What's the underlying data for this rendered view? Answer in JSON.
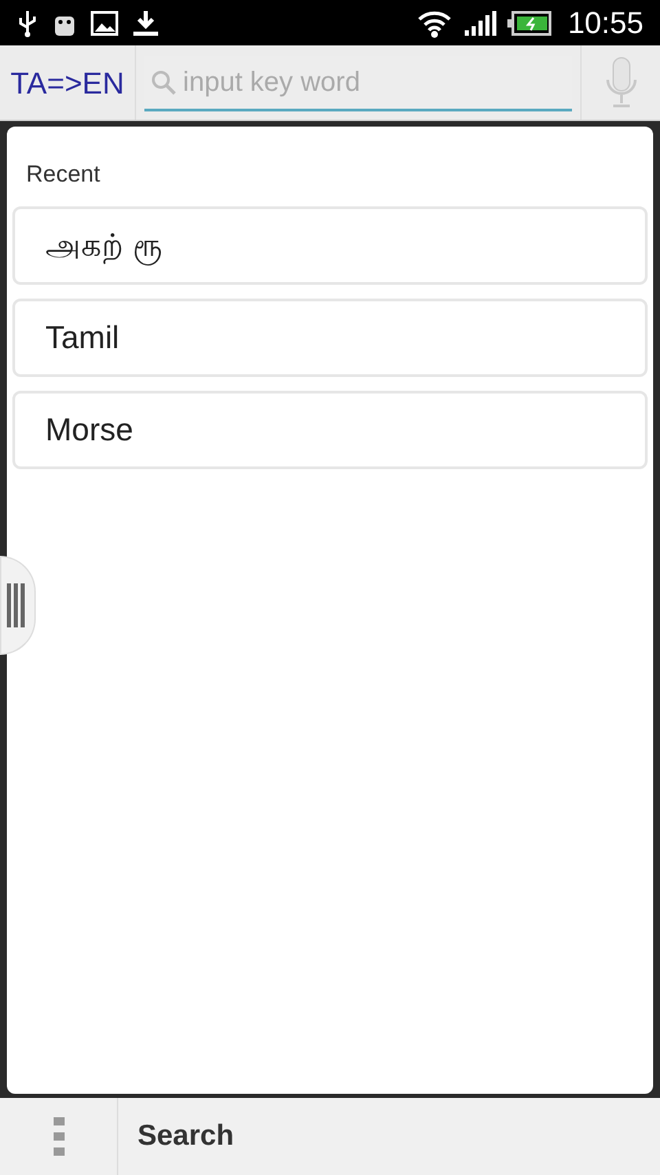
{
  "status_bar": {
    "time": "10:55"
  },
  "toolbar": {
    "language_pair": "TA=>EN",
    "search": {
      "placeholder": "input key word"
    }
  },
  "recent": {
    "title": "Recent",
    "items": [
      {
        "label": "அகற் ரூ"
      },
      {
        "label": "Tamil"
      },
      {
        "label": "Morse"
      }
    ]
  },
  "bottom_bar": {
    "label": "Search"
  }
}
